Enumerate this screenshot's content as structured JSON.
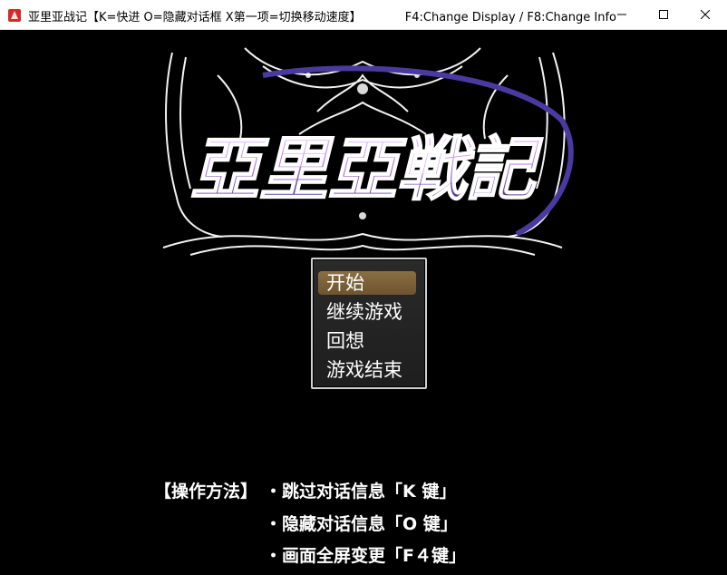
{
  "window": {
    "title": "亚里亚战记【K=快进 O=隐藏对话框 X第一项=切换移动速度】",
    "subtitle": "F4:Change Display / F8:Change Info",
    "icon": "rpg-maker-icon"
  },
  "logo": {
    "text": "亞里亞戦記",
    "colors": {
      "fill_top": "#e8b8f8",
      "fill_bottom": "#3a2a7a",
      "ornament": "#ffffff"
    }
  },
  "menu": {
    "items": [
      {
        "label": "开始",
        "selected": true
      },
      {
        "label": "继续游戏",
        "selected": false
      },
      {
        "label": "回想",
        "selected": false
      },
      {
        "label": "游戏结束",
        "selected": false
      }
    ],
    "colors": {
      "highlight": "#7c6238",
      "border": "#cfcfcf",
      "background": "#242424"
    }
  },
  "help": {
    "heading": "【操作方法】",
    "lines": [
      "・跳过对话信息「K 键」",
      "・隐藏对话信息「O 键」",
      "・画面全屏变更「F４键」"
    ]
  }
}
